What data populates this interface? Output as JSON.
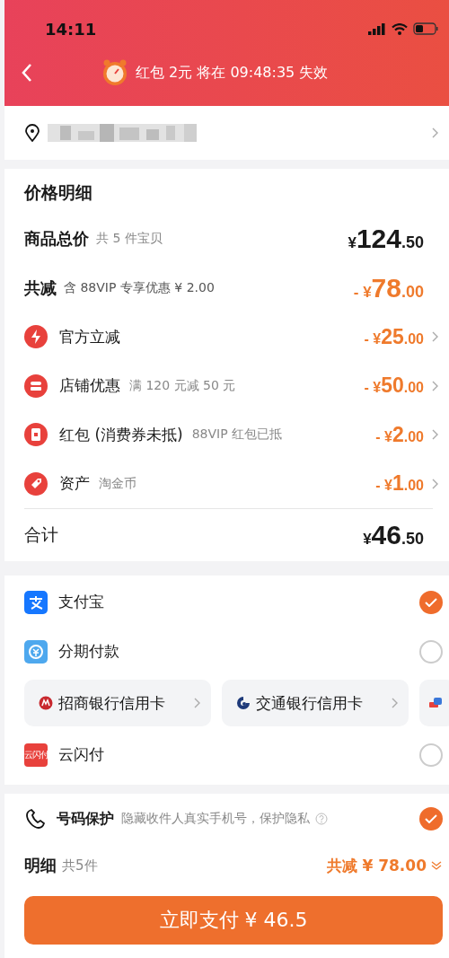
{
  "status_bar": {
    "time": "14:11"
  },
  "header": {
    "countdown": "红包 2元 将在 09:48:35 失效"
  },
  "price_detail": {
    "title": "价格明细",
    "summary": [
      {
        "label": "商品总价",
        "note": "共 5 件宝贝",
        "amount": "¥124.50",
        "kind": "normal"
      },
      {
        "label": "共减",
        "note": "含 88VIP 专享优惠 ¥ 2.00",
        "amount": "- ¥78.00",
        "kind": "discount"
      }
    ],
    "items": [
      {
        "kind": "bolt",
        "label": "官方立减",
        "amount": "- ¥25.00"
      },
      {
        "kind": "shop",
        "label": "店铺优惠",
        "note": "满 120 元减 50 元",
        "amount": "- ¥50.00"
      },
      {
        "kind": "redpacket",
        "label": "红包 (消费券未抵)",
        "note": "88VIP 红包已抵",
        "amount": "- ¥2.00"
      },
      {
        "kind": "tag",
        "label": "资产",
        "note": "淘金币",
        "amount": "- ¥1.00"
      }
    ],
    "total": {
      "label": "合计",
      "amount": "¥46.50"
    }
  },
  "payment": [
    {
      "kind": "alipay",
      "label": "支付宝",
      "selected": true
    },
    {
      "kind": "installment",
      "label": "分期付款",
      "selected": false
    },
    {
      "kind": "cards",
      "cards": [
        {
          "kind": "cmb",
          "label": "招商银行信用卡"
        },
        {
          "kind": "bocom",
          "label": "交通银行信用卡"
        },
        {
          "kind": "other"
        }
      ]
    },
    {
      "kind": "unionpay",
      "label": "云闪付",
      "icon_text": "云闪付",
      "selected": false
    }
  ],
  "privacy": {
    "label": "号码保护",
    "note": "隐藏收件人真实手机号，保护隐私",
    "checked": true
  },
  "footer": {
    "label": "明细",
    "count": "共5件",
    "saving": "共减 ¥ 78.00",
    "button": "立即支付 ¥ 46.5"
  }
}
